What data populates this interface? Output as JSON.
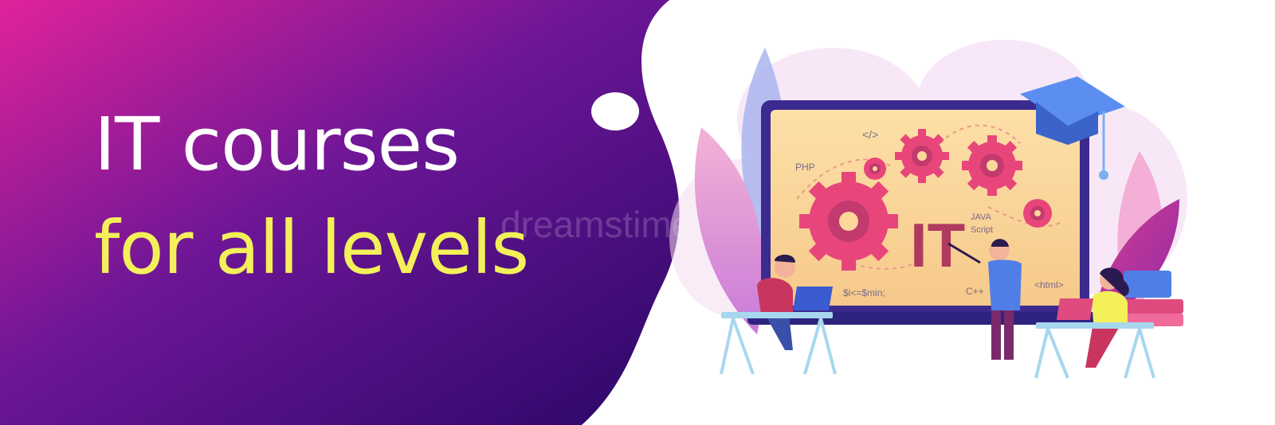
{
  "banner": {
    "headline_line1": "IT courses",
    "headline_line2": "for all levels"
  },
  "screen": {
    "center_label": "IT",
    "code_labels": {
      "tag": "</>",
      "php": "PHP",
      "java": "JAVA",
      "script": "Script",
      "html": "<html>",
      "cpp": "C++",
      "loop": "$i<=$min;"
    }
  },
  "watermark": "dreamstime",
  "colors": {
    "blob_start": "#e0239a",
    "blob_mid": "#6c1696",
    "blob_end": "#2a0766",
    "headline_white": "#ffffff",
    "headline_yellow": "#f3f05a",
    "screen_fill": "#fbd79a",
    "gear": "#e8467b",
    "frame": "#3b2a8f",
    "cap": "#4f7fe6"
  }
}
